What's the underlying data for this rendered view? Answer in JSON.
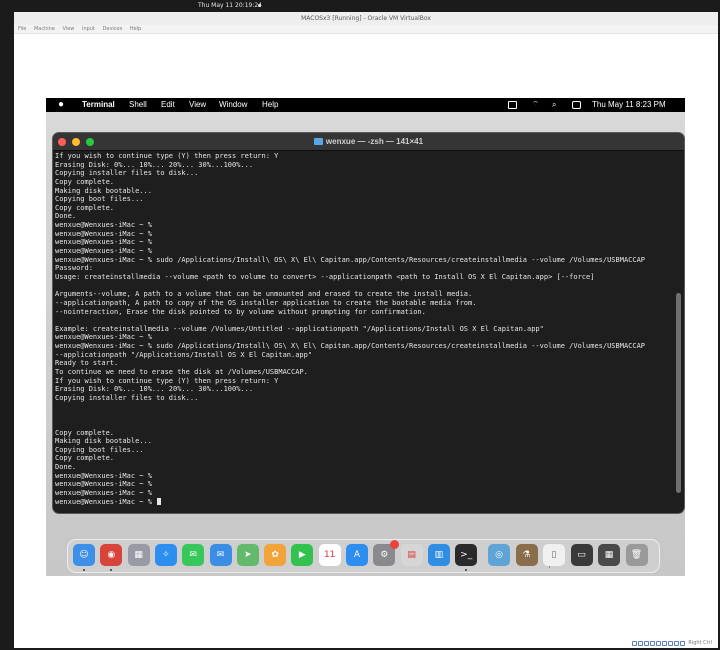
{
  "host": {
    "clock": "Thu May 11  20:19:24"
  },
  "vbox": {
    "title": "MACOSx3 [Running] - Oracle VM VirtualBox",
    "menu": [
      "File",
      "Machine",
      "View",
      "Input",
      "Devices",
      "Help"
    ],
    "status_text": "Right Ctrl"
  },
  "mac_menubar": {
    "apple": "",
    "app_name": "Terminal",
    "menus": [
      "Shell",
      "Edit",
      "View",
      "Window",
      "Help"
    ],
    "clock": "Thu May 11  8:23 PM"
  },
  "terminal": {
    "title": "wenxue — -zsh — 141×41",
    "lines": [
      "If you wish to continue type (Y) then press return: Y",
      "Erasing Disk: 0%... 10%... 20%... 30%...100%...",
      "Copying installer files to disk...",
      "Copy complete.",
      "Making disk bootable...",
      "Copying boot files...",
      "Copy complete.",
      "Done.",
      "wenxue@Wenxues-iMac ~ %",
      "wenxue@Wenxues-iMac ~ %",
      "wenxue@Wenxues-iMac ~ %",
      "wenxue@Wenxues-iMac ~ %",
      "wenxue@Wenxues-iMac ~ % sudo /Applications/Install\\ OS\\ X\\ El\\ Capitan.app/Contents/Resources/createinstallmedia --volume /Volumes/USBMACCAP",
      "Password:",
      "Usage: createinstallmedia --volume <path to volume to convert> --applicationpath <path to Install OS X El Capitan.app> [--force]",
      "",
      "Arguments--volume, A path to a volume that can be unmounted and erased to create the install media.",
      "--applicationpath, A path to copy of the OS installer application to create the bootable media from.",
      "--nointeraction, Erase the disk pointed to by volume without prompting for confirmation.",
      "",
      "Example: createinstallmedia --volume /Volumes/Untitled --applicationpath \"/Applications/Install OS X El Capitan.app\"",
      "wenxue@Wenxues-iMac ~ %",
      "wenxue@Wenxues-iMac ~ % sudo /Applications/Install\\ OS\\ X\\ El\\ Capitan.app/Contents/Resources/createinstallmedia --volume /Volumes/USBMACCAP",
      "--applicationpath \"/Applications/Install OS X El Capitan.app\"",
      "Ready to start.",
      "To continue we need to erase the disk at /Volumes/USBMACCAP.",
      "If you wish to continue type (Y) then press return: Y",
      "Erasing Disk: 0%... 10%... 20%... 30%...100%...",
      "Copying installer files to disk...",
      "",
      "",
      "",
      "Copy complete.",
      "Making disk bootable...",
      "Copying boot files...",
      "Copy complete.",
      "Done.",
      "wenxue@Wenxues-iMac ~ %",
      "wenxue@Wenxues-iMac ~ %",
      "wenxue@Wenxues-iMac ~ %",
      "wenxue@Wenxues-iMac ~ % "
    ]
  },
  "dock": {
    "apps": [
      {
        "name": "finder-icon",
        "color": "#3e8fe8",
        "glyph": "☺"
      },
      {
        "name": "chrome-icon",
        "color": "#d9443a",
        "glyph": "◉"
      },
      {
        "name": "launchpad-icon",
        "color": "#9a9aa6",
        "glyph": "▦"
      },
      {
        "name": "safari-icon",
        "color": "#2b8ef0",
        "glyph": "✧"
      },
      {
        "name": "messages-icon",
        "color": "#37c75a",
        "glyph": "✉"
      },
      {
        "name": "mail-icon",
        "color": "#3a8ee6",
        "glyph": "✉"
      },
      {
        "name": "maps-icon",
        "color": "#63b96c",
        "glyph": "➤"
      },
      {
        "name": "photos-icon",
        "color": "#f2a33a",
        "glyph": "✿"
      },
      {
        "name": "facetime-icon",
        "color": "#34c24f",
        "glyph": "▶"
      },
      {
        "name": "calendar-icon",
        "color": "#ffffff",
        "glyph": "11"
      },
      {
        "name": "app-store-icon",
        "color": "#2d8ef0",
        "glyph": "A"
      },
      {
        "name": "system-preferences-icon",
        "color": "#8a8a8e",
        "glyph": "⚙"
      },
      {
        "name": "preview-icon",
        "color": "#d6d6d6",
        "glyph": "▤"
      },
      {
        "name": "keynote-icon",
        "color": "#2f8de4",
        "glyph": "▥"
      },
      {
        "name": "terminal-icon",
        "color": "#2a2a2a",
        "glyph": ">_"
      }
    ],
    "right_items": [
      {
        "name": "disk-utility-icon",
        "color": "#5fa4d6",
        "glyph": "◎"
      },
      {
        "name": "installer-icon",
        "color": "#8a6d4a",
        "glyph": "⚗"
      },
      {
        "name": "document-icon",
        "color": "#f0f0f0",
        "glyph": "▯"
      },
      {
        "name": "screenshot-icon",
        "color": "#3a3a3a",
        "glyph": "▭"
      },
      {
        "name": "keyboard-icon",
        "color": "#4a4a4a",
        "glyph": "▦"
      },
      {
        "name": "trash-icon",
        "color": "#9a9a9a",
        "glyph": "🗑"
      }
    ]
  },
  "colors": {
    "terminal_bg": "#1e1e1e",
    "terminal_fg": "#e6e6e6",
    "close": "#ff5f57",
    "minimize": "#febc2e",
    "zoom": "#28c840"
  }
}
